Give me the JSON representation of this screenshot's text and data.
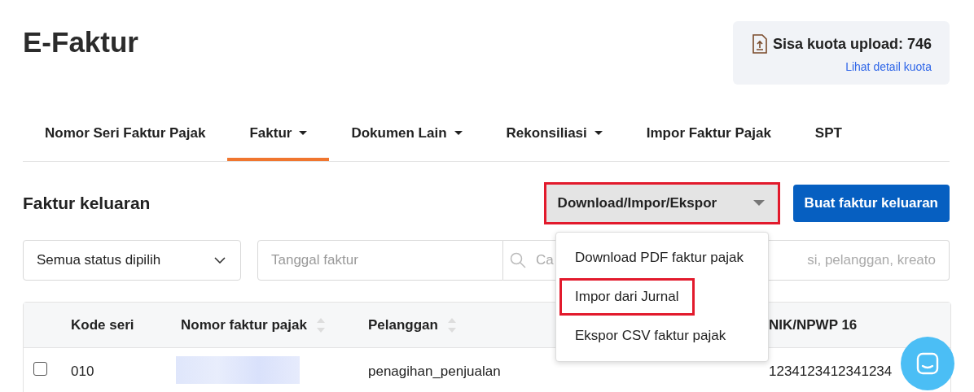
{
  "page_title": "E-Faktur",
  "quota": {
    "label": "Sisa kuota upload: 746",
    "link": "Lihat detail kuota"
  },
  "tabs": [
    {
      "label": "Nomor Seri Faktur Pajak",
      "selected": false,
      "dropdown": false
    },
    {
      "label": "Faktur",
      "selected": true,
      "dropdown": true
    },
    {
      "label": "Dokumen Lain",
      "selected": false,
      "dropdown": true
    },
    {
      "label": "Rekonsiliasi",
      "selected": false,
      "dropdown": true
    },
    {
      "label": "Impor Faktur Pajak",
      "selected": false,
      "dropdown": false
    },
    {
      "label": "SPT",
      "selected": false,
      "dropdown": false
    }
  ],
  "section_title": "Faktur keluaran",
  "actions": {
    "menu_button": {
      "label": "Download/Impor/Ekspor",
      "highlighted": true
    },
    "primary_button": "Buat faktur keluaran"
  },
  "menu": [
    {
      "label": "Download PDF faktur pajak",
      "highlighted": false
    },
    {
      "label": "Impor dari Jurnal",
      "highlighted": true
    },
    {
      "label": "Ekspor CSV faktur pajak",
      "highlighted": false
    }
  ],
  "filters": {
    "status": "Semua status dipilih",
    "date_placeholder": "Tanggal faktur",
    "search_placeholder_start": "Ca",
    "search_placeholder_end": "si, pelanggan, kreato"
  },
  "table": {
    "columns": [
      {
        "label": "Kode seri",
        "sortable": false
      },
      {
        "label": "Nomor faktur pajak",
        "sortable": true
      },
      {
        "label": "Pelanggan",
        "sortable": true
      },
      {
        "label": "NIK/NPWP 16",
        "sortable": false
      }
    ],
    "rows": [
      {
        "checked": false,
        "cells": [
          "010",
          null,
          "penagihan_penjualan",
          "1234123412341234"
        ]
      }
    ]
  }
}
